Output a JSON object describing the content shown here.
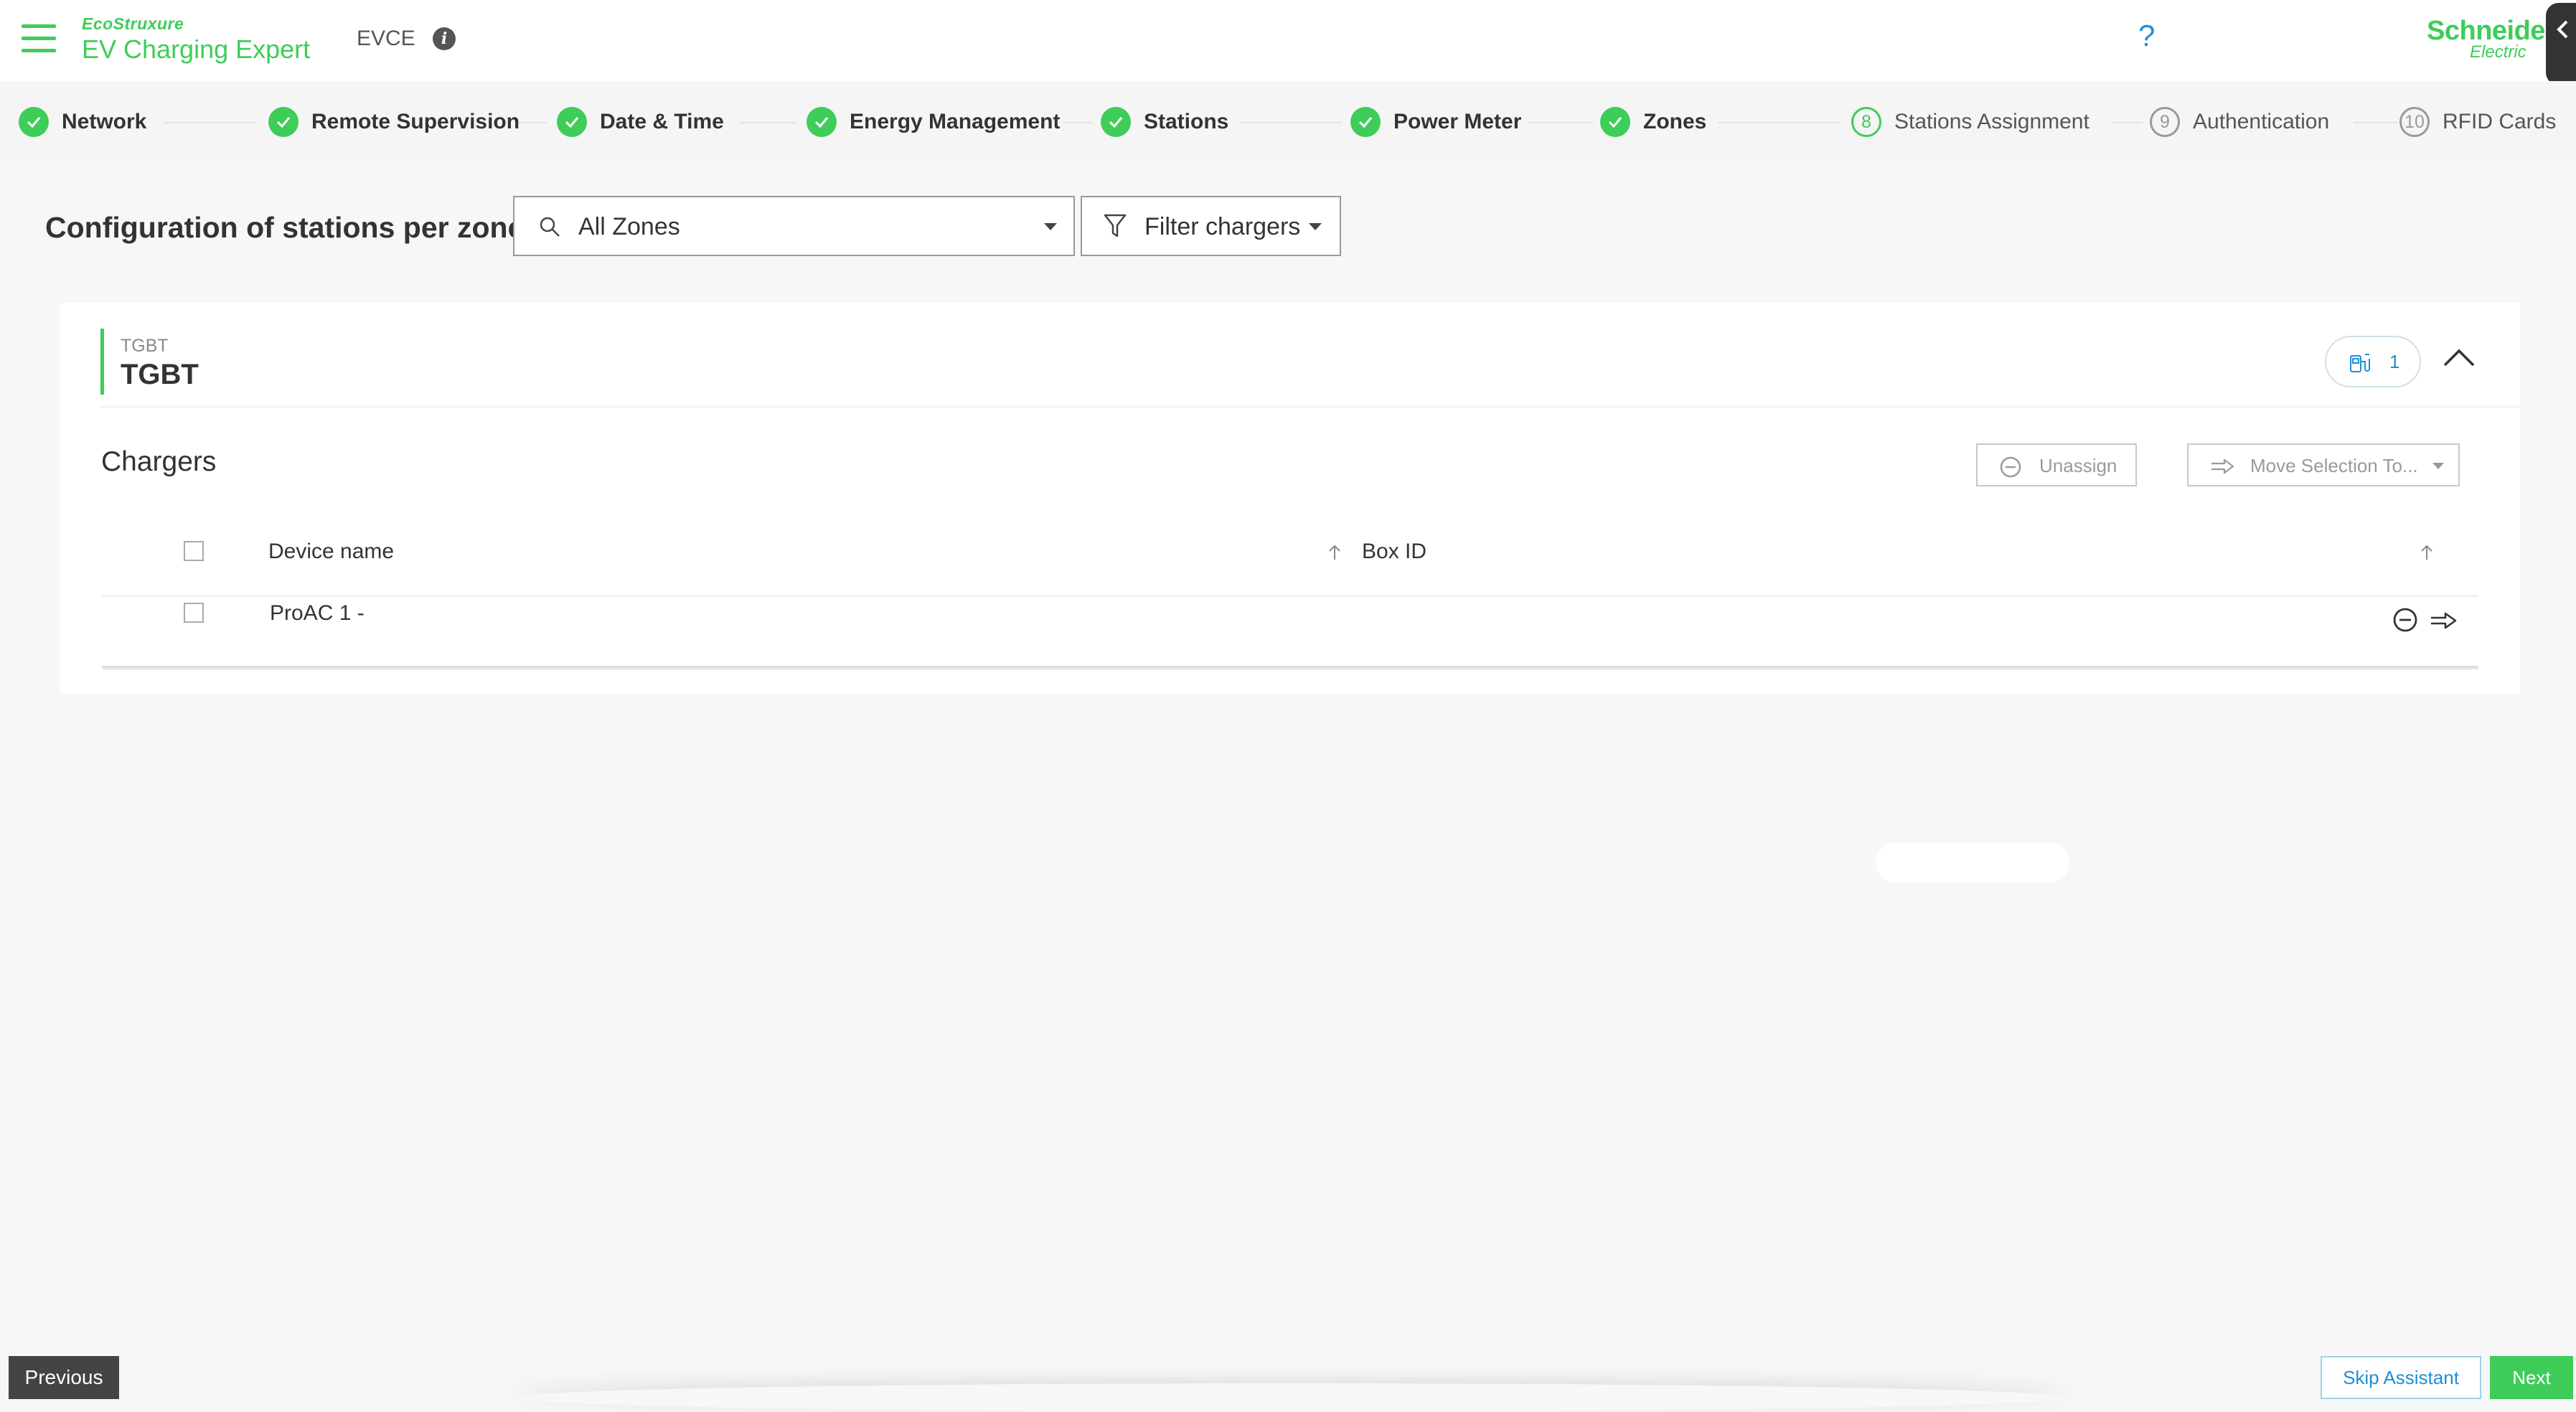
{
  "header": {
    "eco_logo": "EcoStruxure",
    "app_name": "EV Charging Expert",
    "site_name": "EVCE",
    "help": "?",
    "brand_line1": "Schneider",
    "brand_line2": "Electric"
  },
  "stepper": {
    "steps": [
      {
        "label": "Network",
        "state": "done"
      },
      {
        "label": "Remote Supervision",
        "state": "done"
      },
      {
        "label": "Date & Time",
        "state": "done"
      },
      {
        "label": "Energy Management",
        "state": "done"
      },
      {
        "label": "Stations",
        "state": "done"
      },
      {
        "label": "Power Meter",
        "state": "done"
      },
      {
        "label": "Zones",
        "state": "done"
      },
      {
        "label": "Stations Assignment",
        "state": "active",
        "number": "8"
      },
      {
        "label": "Authentication",
        "state": "pending",
        "number": "9"
      },
      {
        "label": "RFID Cards",
        "state": "pending",
        "number": "10"
      }
    ]
  },
  "toolbar": {
    "title": "Configuration of stations per zone",
    "zone_select": "All Zones",
    "filter_label": "Filter chargers"
  },
  "zone": {
    "subtitle": "TGBT",
    "title": "TGBT",
    "station_count": "1"
  },
  "chargers": {
    "title": "Chargers",
    "unassign_label": "Unassign",
    "move_label": "Move Selection To...",
    "columns": [
      "Device name",
      "Box ID"
    ],
    "rows": [
      {
        "device_name": "ProAC 1 -",
        "box_id": ""
      }
    ]
  },
  "footer": {
    "previous": "Previous",
    "skip": "Skip Assistant",
    "next": "Next"
  },
  "colors": {
    "accent": "#3dcd58",
    "link": "#1f8fd6",
    "dark": "#444444"
  }
}
